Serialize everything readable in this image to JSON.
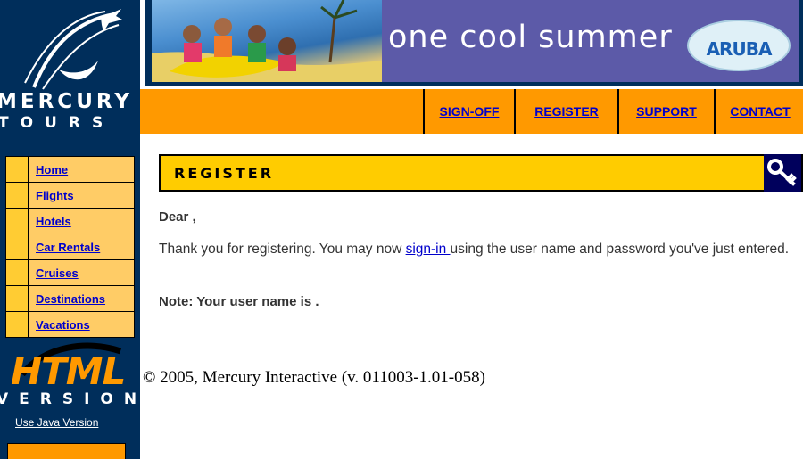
{
  "logo": {
    "line1": "MERCURY",
    "line2": "TOURS"
  },
  "banner": {
    "tagline": "one cool summer",
    "aruba": "ARUBA"
  },
  "topnav": {
    "items": [
      "SIGN-OFF",
      "REGISTER",
      "SUPPORT",
      "CONTACT"
    ]
  },
  "sidebar": {
    "items": [
      "Home",
      "Flights",
      "Hotels",
      "Car Rentals",
      "Cruises",
      "Destinations",
      "Vacations"
    ],
    "html_badge": "HTML",
    "version_badge": "VERSION",
    "java_link": "Use Java Version"
  },
  "main": {
    "header": "REGISTER",
    "dear": "Dear  ,",
    "thanks_before": "Thank you for registering. You may now ",
    "signin_link": "sign-in ",
    "thanks_after": "using the user name and password you've just entered.",
    "note": "Note: Your user name is .",
    "copyright": "© 2005, Mercury Interactive (v. 011003-1.01-058)"
  },
  "colors": {
    "navy": "#002e5b",
    "orange": "#ff9900",
    "gold": "#ffcc00",
    "link": "#0000cc"
  },
  "icons": [
    "plane-logo-icon",
    "key-icon"
  ]
}
